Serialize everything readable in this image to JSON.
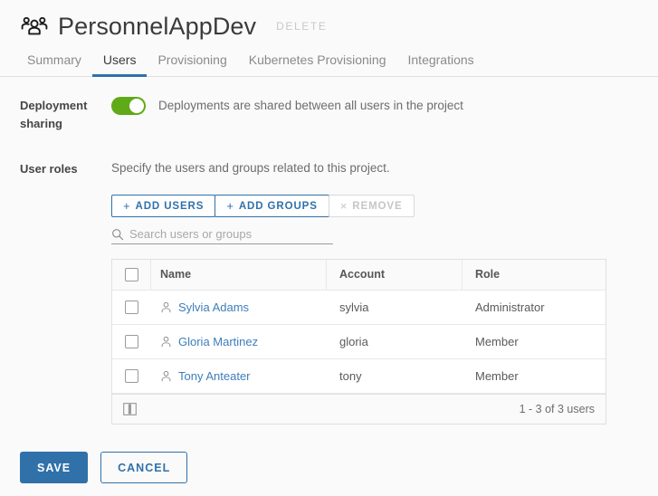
{
  "header": {
    "icon": "users-group-icon",
    "title": "PersonnelAppDev",
    "delete_label": "DELETE"
  },
  "tabs": [
    {
      "label": "Summary",
      "active": false
    },
    {
      "label": "Users",
      "active": true
    },
    {
      "label": "Provisioning",
      "active": false
    },
    {
      "label": "Kubernetes Provisioning",
      "active": false
    },
    {
      "label": "Integrations",
      "active": false
    }
  ],
  "deployment_sharing": {
    "label_line1": "Deployment",
    "label_line2": "sharing",
    "toggle_on": true,
    "toggle_color": "#60a917",
    "description": "Deployments are shared between all users in the project"
  },
  "user_roles": {
    "label": "User roles",
    "helper_text": "Specify the users and groups related to this project.",
    "buttons": [
      {
        "label": "ADD USERS",
        "icon": "plus-icon",
        "glyph": "+",
        "disabled": false
      },
      {
        "label": "ADD GROUPS",
        "icon": "plus-icon",
        "glyph": "+",
        "disabled": false
      },
      {
        "label": "REMOVE",
        "icon": "close-icon",
        "glyph": "×",
        "disabled": true
      }
    ],
    "search": {
      "icon": "search-icon",
      "placeholder": "Search users or groups",
      "value": ""
    },
    "table": {
      "columns": [
        "Name",
        "Account",
        "Role"
      ],
      "rows": [
        {
          "name": "Sylvia Adams",
          "account": "sylvia",
          "role": "Administrator",
          "checked": false
        },
        {
          "name": "Gloria Martinez",
          "account": "gloria",
          "role": "Member",
          "checked": false
        },
        {
          "name": "Tony Anteater",
          "account": "tony",
          "role": "Member",
          "checked": false
        }
      ],
      "footer": {
        "columns_icon": "columns-toggle-icon",
        "count_text": "1 - 3 of 3 users"
      }
    }
  },
  "footer": {
    "save_label": "SAVE",
    "cancel_label": "CANCEL",
    "primary_color": "#3071a9"
  }
}
